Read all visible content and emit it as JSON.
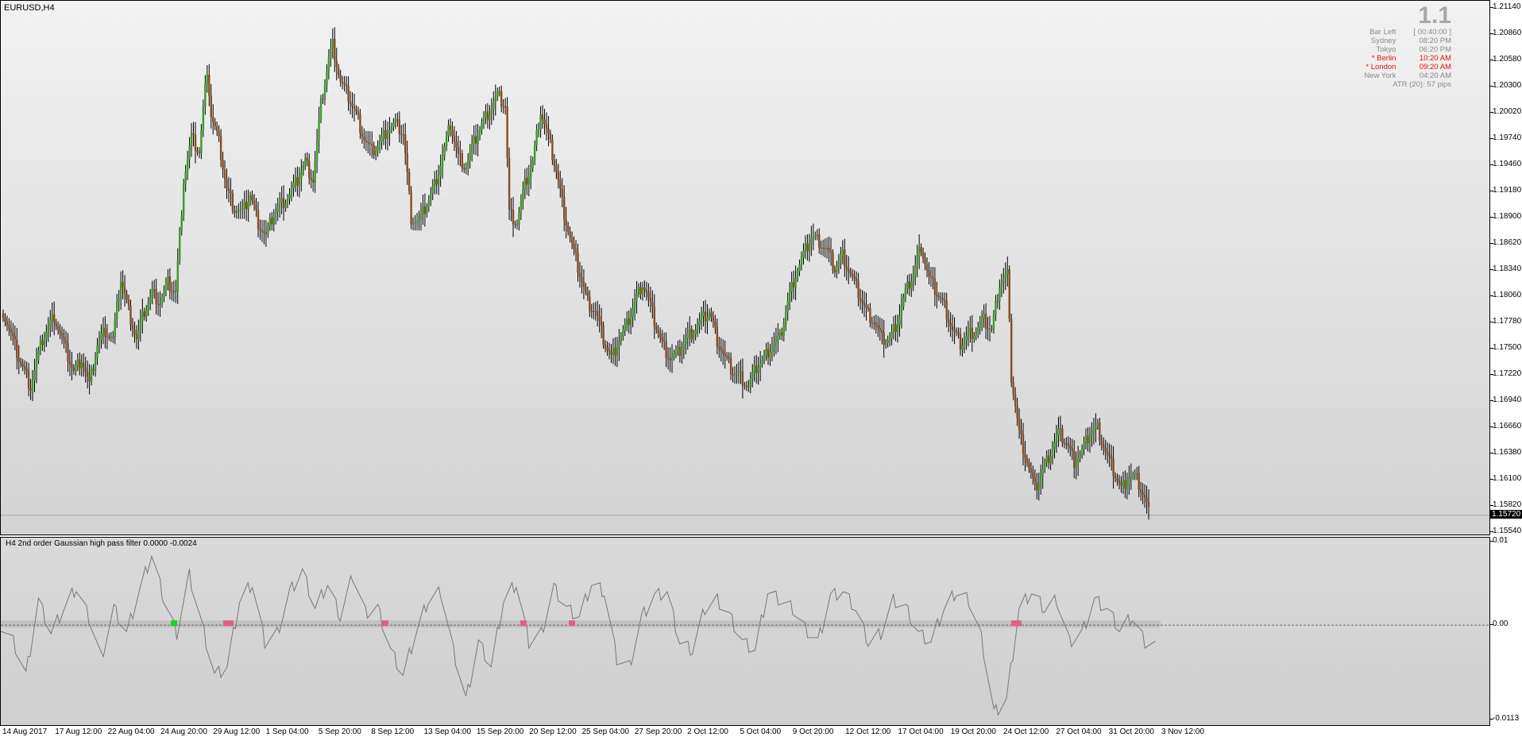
{
  "symbol_label": "EURUSD,H4",
  "indicator_label": "H4 2nd order Gaussian high pass filter 0.0000 -0.0024",
  "info_panel": {
    "big_number": "1.1",
    "rows": [
      {
        "k": "Bar Left",
        "v": "[ 00:40:00 ]",
        "color": "#888888"
      },
      {
        "k": "Sydney",
        "v": "08:20 PM",
        "color": "#888888"
      },
      {
        "k": "Tokyo",
        "v": "06:20 PM",
        "color": "#888888"
      },
      {
        "k": "* Berlin",
        "v": "10:20 AM",
        "color": "#e01010"
      },
      {
        "k": "* London",
        "v": "09:20 AM",
        "color": "#e01010"
      },
      {
        "k": "New York",
        "v": "04:20 AM",
        "color": "#888888"
      }
    ],
    "atr": "ATR (20): 57 pips"
  },
  "price_axis": [
    "1.21140",
    "1.20860",
    "1.20580",
    "1.20300",
    "1.20020",
    "1.19740",
    "1.19460",
    "1.19180",
    "1.18900",
    "1.18620",
    "1.18340",
    "1.18060",
    "1.17780",
    "1.17500",
    "1.17220",
    "1.16940",
    "1.16660",
    "1.16380",
    "1.16100",
    "1.15820",
    "1.15540"
  ],
  "current_price": "1.15720",
  "ind_axis": [
    "0.01",
    "0.00",
    "-0.0113"
  ],
  "time_axis": [
    "14 Aug 2017",
    "17 Aug 12:00",
    "22 Aug 04:00",
    "24 Aug 20:00",
    "29 Aug 12:00",
    "1 Sep 04:00",
    "5 Sep 20:00",
    "8 Sep 12:00",
    "13 Sep 04:00",
    "15 Sep 20:00",
    "20 Sep 12:00",
    "25 Sep 04:00",
    "27 Sep 20:00",
    "2 Oct 12:00",
    "5 Oct 04:00",
    "9 Oct 20:00",
    "12 Oct 12:00",
    "17 Oct 04:00",
    "19 Oct 20:00",
    "24 Oct 12:00",
    "27 Oct 04:00",
    "31 Oct 20:00",
    "3 Nov 12:00"
  ],
  "colors": {
    "up": "#3c9a28",
    "down": "#8a4a20",
    "wick": "#000000",
    "filter_line": "#777777",
    "mark_green": "#22cc22",
    "mark_pink": "#e06080"
  },
  "chart_data": [
    {
      "type": "candlestick",
      "title": "EURUSD,H4",
      "ylim": [
        1.1554,
        1.2114
      ],
      "close_path": [
        [
          0,
          1.179
        ],
        [
          8,
          1.174
        ],
        [
          14,
          1.171
        ],
        [
          20,
          1.176
        ],
        [
          26,
          1.1785
        ],
        [
          30,
          1.176
        ],
        [
          36,
          1.1725
        ],
        [
          40,
          1.174
        ],
        [
          44,
          1.171
        ],
        [
          48,
          1.1755
        ],
        [
          52,
          1.177
        ],
        [
          56,
          1.176
        ],
        [
          60,
          1.1825
        ],
        [
          64,
          1.179
        ],
        [
          68,
          1.176
        ],
        [
          72,
          1.179
        ],
        [
          76,
          1.181
        ],
        [
          80,
          1.18
        ],
        [
          84,
          1.182
        ],
        [
          88,
          1.181
        ],
        [
          92,
          1.193
        ],
        [
          96,
          1.1975
        ],
        [
          100,
          1.196
        ],
        [
          104,
          1.205
        ],
        [
          106,
          1.2
        ],
        [
          110,
          1.197
        ],
        [
          114,
          1.192
        ],
        [
          118,
          1.19
        ],
        [
          122,
          1.1895
        ],
        [
          126,
          1.1915
        ],
        [
          130,
          1.1885
        ],
        [
          134,
          1.187
        ],
        [
          138,
          1.1895
        ],
        [
          142,
          1.1905
        ],
        [
          146,
          1.1915
        ],
        [
          150,
          1.193
        ],
        [
          154,
          1.195
        ],
        [
          158,
          1.193
        ],
        [
          162,
          1.201
        ],
        [
          166,
          1.206
        ],
        [
          168,
          1.2075
        ],
        [
          172,
          1.2035
        ],
        [
          176,
          1.202
        ],
        [
          180,
          1.2
        ],
        [
          184,
          1.1975
        ],
        [
          188,
          1.196
        ],
        [
          192,
          1.197
        ],
        [
          196,
          1.1985
        ],
        [
          200,
          1.199
        ],
        [
          204,
          1.198
        ],
        [
          208,
          1.189
        ],
        [
          212,
          1.1885
        ],
        [
          216,
          1.1905
        ],
        [
          220,
          1.1925
        ],
        [
          224,
          1.1955
        ],
        [
          228,
          1.199
        ],
        [
          232,
          1.1955
        ],
        [
          236,
          1.1945
        ],
        [
          240,
          1.197
        ],
        [
          244,
          1.199
        ],
        [
          248,
          1.2005
        ],
        [
          252,
          1.202
        ],
        [
          256,
          1.201
        ],
        [
          258,
          1.1895
        ],
        [
          262,
          1.1885
        ],
        [
          266,
          1.1925
        ],
        [
          270,
          1.195
        ],
        [
          274,
          1.2005
        ],
        [
          278,
          1.1975
        ],
        [
          282,
          1.194
        ],
        [
          286,
          1.1895
        ],
        [
          290,
          1.186
        ],
        [
          294,
          1.183
        ],
        [
          298,
          1.18
        ],
        [
          302,
          1.179
        ],
        [
          306,
          1.176
        ],
        [
          310,
          1.174
        ],
        [
          314,
          1.176
        ],
        [
          318,
          1.1775
        ],
        [
          322,
          1.18
        ],
        [
          326,
          1.182
        ],
        [
          328,
          1.181
        ],
        [
          332,
          1.178
        ],
        [
          336,
          1.1755
        ],
        [
          340,
          1.174
        ],
        [
          344,
          1.1745
        ],
        [
          348,
          1.176
        ],
        [
          352,
          1.177
        ],
        [
          356,
          1.178
        ],
        [
          360,
          1.179
        ],
        [
          364,
          1.176
        ],
        [
          368,
          1.174
        ],
        [
          372,
          1.1725
        ],
        [
          376,
          1.172
        ],
        [
          380,
          1.171
        ],
        [
          384,
          1.173
        ],
        [
          388,
          1.174
        ],
        [
          392,
          1.1755
        ],
        [
          396,
          1.176
        ],
        [
          400,
          1.18
        ],
        [
          404,
          1.183
        ],
        [
          408,
          1.185
        ],
        [
          412,
          1.187
        ],
        [
          416,
          1.1865
        ],
        [
          420,
          1.1855
        ],
        [
          424,
          1.1835
        ],
        [
          428,
          1.185
        ],
        [
          432,
          1.183
        ],
        [
          436,
          1.181
        ],
        [
          440,
          1.179
        ],
        [
          444,
          1.178
        ],
        [
          448,
          1.176
        ],
        [
          452,
          1.176
        ],
        [
          456,
          1.178
        ],
        [
          460,
          1.181
        ],
        [
          464,
          1.183
        ],
        [
          468,
          1.186
        ],
        [
          472,
          1.1825
        ],
        [
          476,
          1.181
        ],
        [
          480,
          1.1795
        ],
        [
          484,
          1.177
        ],
        [
          488,
          1.1755
        ],
        [
          492,
          1.1765
        ],
        [
          496,
          1.177
        ],
        [
          500,
          1.178
        ],
        [
          504,
          1.177
        ],
        [
          508,
          1.182
        ],
        [
          512,
          1.183
        ],
        [
          514,
          1.172
        ],
        [
          518,
          1.166
        ],
        [
          522,
          1.163
        ],
        [
          526,
          1.16
        ],
        [
          530,
          1.162
        ],
        [
          534,
          1.164
        ],
        [
          538,
          1.166
        ],
        [
          542,
          1.165
        ],
        [
          546,
          1.163
        ],
        [
          550,
          1.164
        ],
        [
          554,
          1.166
        ],
        [
          558,
          1.1665
        ],
        [
          562,
          1.164
        ],
        [
          566,
          1.162
        ],
        [
          570,
          1.16
        ],
        [
          574,
          1.1615
        ],
        [
          578,
          1.161
        ],
        [
          582,
          1.159
        ],
        [
          584,
          1.1575
        ]
      ]
    },
    {
      "type": "line",
      "title": "H4 2nd order Gaussian high pass filter 0.0000 -0.0024",
      "ylim": [
        -0.0113,
        0.01
      ],
      "series": [
        {
          "values": [
            0,
            -0.002,
            -0.006,
            0.003,
            -0.001,
            0.002,
            0.0045,
            0.001,
            -0.004,
            0.002,
            -0.001,
            0.004,
            0.0085,
            0.003,
            -0.001,
            0.006,
            0,
            -0.006,
            -0.005,
            0.003,
            0.005,
            -0.002,
            -0.001,
            0.004,
            0.0065,
            0.002,
            0.005,
            0.001,
            0.006,
            0.0015,
            0.002,
            -0.003,
            -0.006,
            -0.001,
            0.003,
            0.004,
            -0.003,
            -0.009,
            -0.002,
            -0.005,
            0.003,
            0.005,
            -0.002,
            -0.001,
            0.0045,
            0.002,
            0.001,
            0.005,
            0.004,
            -0.004,
            -0.005,
            0.001,
            0.0035,
            0.004,
            -0.002,
            -0.003,
            0.002,
            0.003,
            0.001,
            -0.002,
            -0.003,
            0.004,
            0.003,
            0.002,
            -0.0005,
            -0.002,
            0.0035,
            0.004,
            0.002,
            -0.002,
            -0.001,
            0.003,
            0.002,
            -0.001,
            -0.002,
            0.002,
            0.004,
            0.003,
            -0.0015,
            -0.0105,
            -0.009,
            0.002,
            0.004,
            0.002,
            0.003,
            -0.002,
            -0.001,
            0.003,
            0.002,
            -0.0005,
            0.001,
            -0.002,
            -0.0025
          ]
        }
      ]
    }
  ]
}
